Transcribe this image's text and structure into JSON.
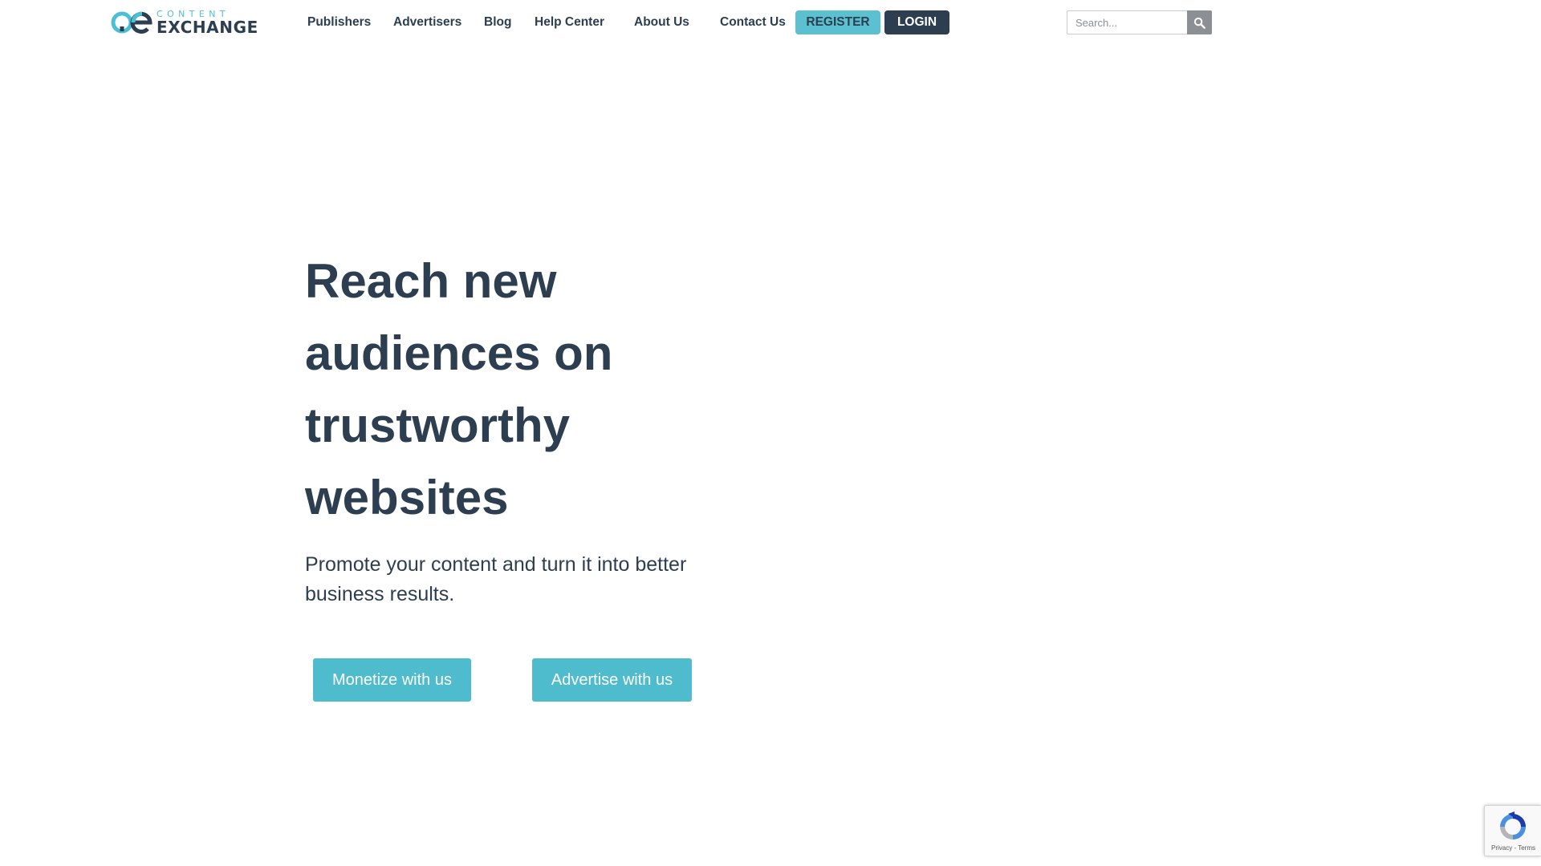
{
  "brand": {
    "logo_top": "CONTENT",
    "logo_bottom": "EXCHANGE",
    "accent_color": "#4dbfd4",
    "dark_color": "#2c3e50"
  },
  "nav": {
    "items": [
      {
        "label": "Publishers"
      },
      {
        "label": "Advertisers"
      },
      {
        "label": "Blog"
      },
      {
        "label": "Help Center"
      },
      {
        "label": "About Us"
      },
      {
        "label": "Contact Us"
      }
    ],
    "register_label": "REGISTER",
    "login_label": "LOGIN"
  },
  "search": {
    "placeholder": "Search...",
    "value": "",
    "icon": "search-icon"
  },
  "hero": {
    "title": "Reach new audiences on trustworthy websites",
    "subtitle": "Promote your content and turn it into better business results.",
    "cta_monetize": "Monetize with us",
    "cta_advertise": "Advertise with us",
    "cta_color": "#4fbccd"
  },
  "recaptcha": {
    "privacy_label": "Privacy",
    "separator": "-",
    "terms_label": "Terms",
    "icon": "recaptcha-icon"
  }
}
